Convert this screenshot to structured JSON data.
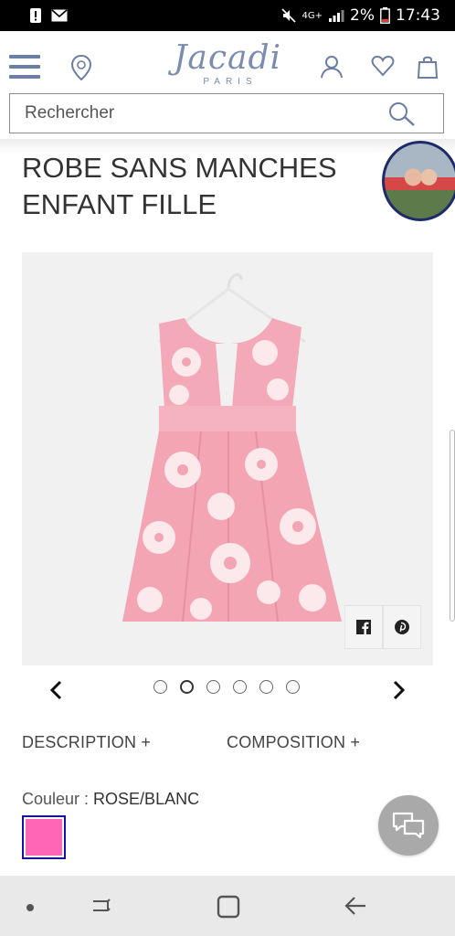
{
  "status_bar": {
    "network": "4G+",
    "battery": "2%",
    "time": "17:43"
  },
  "header": {
    "brand": "Jacadi",
    "brand_sub": "PARIS"
  },
  "search": {
    "placeholder": "Rechercher"
  },
  "product": {
    "title_line1": "ROBE SANS MANCHES",
    "title_line2": "ENFANT FILLE"
  },
  "carousel": {
    "slide_count": 6,
    "active_index": 1
  },
  "tabs": {
    "description": "DESCRIPTION +",
    "composition": "COMPOSITION +"
  },
  "color": {
    "label": "Couleur : ",
    "value": "ROSE/BLANC",
    "swatch_color": "#ff66b3"
  },
  "colors": {
    "brand": "#7a8db0",
    "accent_border": "#1515a0"
  }
}
